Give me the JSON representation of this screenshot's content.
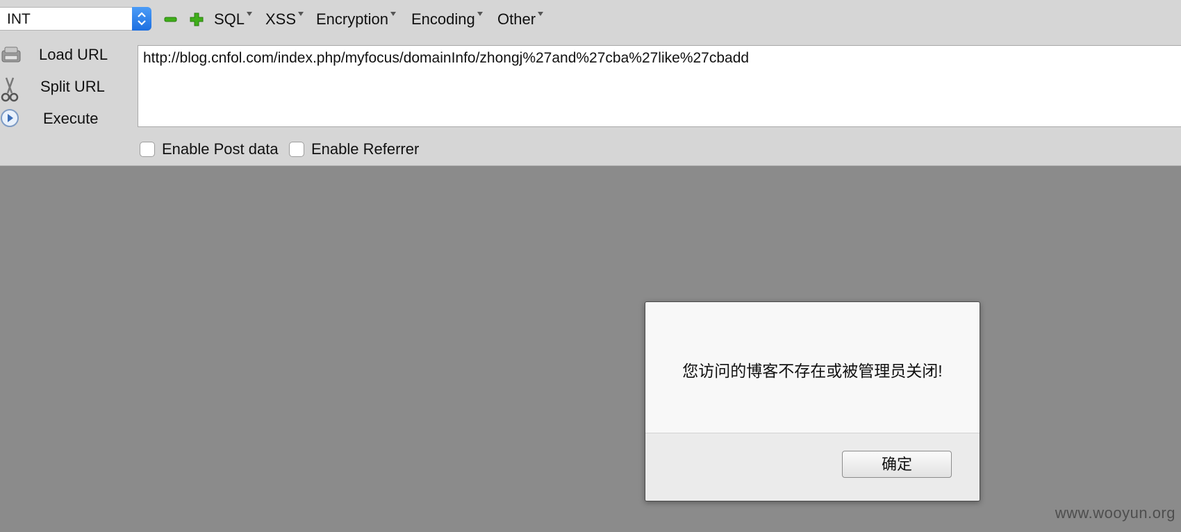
{
  "toolbar": {
    "injection_type": {
      "selected": "INT"
    },
    "decrease_icon": "minus-icon",
    "increase_icon": "plus-icon",
    "menus": {
      "sql": "SQL",
      "xss": "XSS",
      "encryption": "Encryption",
      "encoding": "Encoding",
      "other": "Other"
    }
  },
  "actions": {
    "load_url": {
      "label": "Load URL",
      "icon": "load-icon"
    },
    "split_url": {
      "label": "Split URL",
      "icon": "scissors-icon"
    },
    "execute": {
      "label": "Execute",
      "icon": "play-icon"
    }
  },
  "url": {
    "value": "http://blog.cnfol.com/index.php/myfocus/domainInfo/zhongj%27and%27cba%27like%27cbadd"
  },
  "options": {
    "post_data": {
      "label": "Enable Post data",
      "checked": false
    },
    "referrer": {
      "label": "Enable Referrer",
      "checked": false
    }
  },
  "dialog": {
    "message": "您访问的博客不存在或被管理员关闭!",
    "ok_label": "确定"
  },
  "watermark": "www.wooyun.org",
  "colors": {
    "toolbar_bg": "#d6d6d6",
    "content_bg": "#8b8b8b",
    "select_accent": "#2b7ceb",
    "icon_green": "#3fae1a"
  }
}
